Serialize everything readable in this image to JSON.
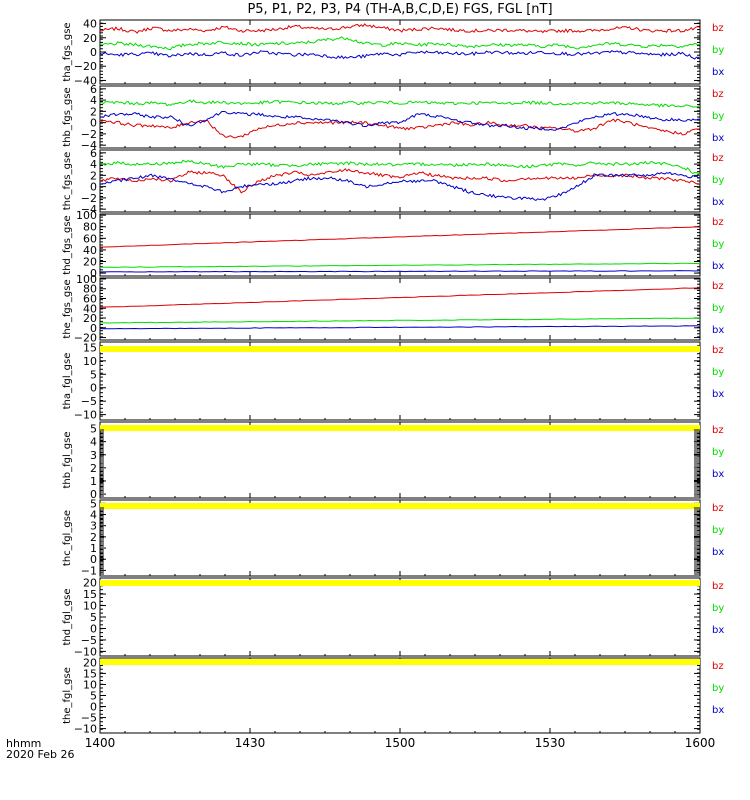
{
  "title": "P5, P1, P2, P3, P4 (TH-A,B,C,D,E) FGS, FGL [nT]",
  "footer": {
    "time_format": "hhmm",
    "date": "2020 Feb 26"
  },
  "colors": {
    "bz": "#dd0000",
    "by": "#00dd00",
    "bx": "#0000cc",
    "flag": "#ffff00",
    "axis": "#000000"
  },
  "chart_data": [
    {
      "type": "line",
      "ylabel": "tha_fgs_gse",
      "ylim": [
        -45,
        45
      ],
      "yticks": [
        "40",
        "20",
        "0",
        "−20",
        "−40"
      ],
      "ytick_values": [
        40,
        20,
        0,
        -20,
        -40
      ],
      "legend": [
        "bz",
        "by",
        "bx"
      ],
      "x": [
        "1400",
        "1430",
        "1500",
        "1530",
        "1600"
      ],
      "series": [
        {
          "name": "bz",
          "values": [
            30,
            33,
            28,
            34,
            30,
            32,
            30,
            35,
            30,
            30,
            32,
            36,
            33,
            32,
            35,
            38,
            34,
            30,
            32,
            34,
            31,
            30,
            30,
            31,
            30,
            28,
            30,
            30,
            30,
            33,
            34,
            30,
            30,
            30,
            34
          ]
        },
        {
          "name": "by",
          "values": [
            10,
            12,
            10,
            8,
            5,
            11,
            12,
            14,
            12,
            10,
            12,
            12,
            14,
            18,
            20,
            12,
            10,
            12,
            10,
            12,
            10,
            8,
            10,
            10,
            10,
            8,
            10,
            6,
            10,
            12,
            10,
            8,
            10,
            8,
            12
          ]
        },
        {
          "name": "bx",
          "values": [
            -2,
            -4,
            -3,
            -2,
            -6,
            -2,
            -4,
            -1,
            -5,
            0,
            -2,
            -4,
            -3,
            -6,
            -8,
            -6,
            -2,
            -4,
            0,
            -1,
            -2,
            -3,
            0,
            -1,
            -2,
            0,
            -2,
            -3,
            -2,
            0,
            -1,
            -3,
            -4,
            -2,
            -10
          ]
        }
      ]
    },
    {
      "type": "line",
      "ylabel": "thb_fgs_gse",
      "ylim": [
        -4.5,
        6.5
      ],
      "yticks": [
        "6",
        "4",
        "2",
        "0",
        "−2",
        "−4"
      ],
      "ytick_values": [
        6,
        4,
        2,
        0,
        -2,
        -4
      ],
      "legend": [
        "bz",
        "by",
        "bx"
      ],
      "x": [
        "1400",
        "1430",
        "1500",
        "1530",
        "1600"
      ],
      "series": [
        {
          "name": "bz",
          "values": [
            0.5,
            0,
            -0.5,
            -0.5,
            -1,
            0,
            0.5,
            -2.5,
            -2.5,
            -1,
            -0.5,
            0,
            0,
            0,
            0,
            0,
            -0.5,
            -1,
            -1,
            -0.5,
            0,
            -0.5,
            0,
            -0.5,
            -0.5,
            -1,
            -1,
            -1.5,
            -1,
            0.5,
            0,
            -1,
            -1.5,
            -2,
            -1
          ]
        },
        {
          "name": "by",
          "values": [
            3.5,
            3.6,
            3.4,
            3.5,
            3.2,
            3.8,
            3.6,
            3.6,
            3.4,
            3.5,
            3.7,
            3.6,
            3.5,
            3.4,
            3.5,
            3.5,
            3.6,
            3.5,
            3.6,
            3.5,
            3.4,
            3.5,
            3.5,
            3.4,
            3.6,
            3.5,
            3.4,
            3.4,
            3.5,
            3.5,
            3.4,
            3.2,
            3.0,
            2.9,
            2.9
          ]
        },
        {
          "name": "bx",
          "values": [
            1.0,
            1.5,
            1.5,
            1.0,
            1.0,
            -0.5,
            0.5,
            2.0,
            1.5,
            1.5,
            1.0,
            1.0,
            0.5,
            0.5,
            0,
            -0.5,
            0,
            0,
            1.5,
            1.2,
            0.5,
            0,
            -0.5,
            -0.5,
            -1,
            -1,
            -1.2,
            0,
            1.0,
            1.5,
            1.5,
            1.0,
            0.5,
            0.5,
            0.5
          ]
        }
      ]
    },
    {
      "type": "line",
      "ylabel": "thc_fgs_gse",
      "ylim": [
        -4.5,
        6.5
      ],
      "yticks": [
        "6",
        "4",
        "2",
        "0",
        "−2",
        "−4"
      ],
      "ytick_values": [
        6,
        4,
        2,
        0,
        -2,
        -4
      ],
      "legend": [
        "bz",
        "by",
        "bx"
      ],
      "x": [
        "1400",
        "1430",
        "1500",
        "1530",
        "1600"
      ],
      "series": [
        {
          "name": "bz",
          "values": [
            1.0,
            1.5,
            1.0,
            1.5,
            1.0,
            2.5,
            2.5,
            2.0,
            -1.0,
            1.0,
            2.0,
            2.5,
            2.0,
            2.5,
            3.0,
            2.5,
            2.0,
            1.5,
            2.5,
            2.0,
            1.5,
            1.5,
            1.5,
            1.0,
            1.5,
            1.5,
            1.5,
            1.5,
            2.0,
            2.0,
            2.0,
            1.5,
            1.5,
            1.0,
            0.5
          ]
        },
        {
          "name": "by",
          "values": [
            4.0,
            4.2,
            4.0,
            4.0,
            4.2,
            4.5,
            4.0,
            3.5,
            4.0,
            4.0,
            3.8,
            3.8,
            4.0,
            4.0,
            4.2,
            4.0,
            4.0,
            3.8,
            4.0,
            4.0,
            3.8,
            4.0,
            4.0,
            3.8,
            3.5,
            3.8,
            4.0,
            3.8,
            4.2,
            4.0,
            4.0,
            4.2,
            4.0,
            3.5,
            2.0
          ]
        },
        {
          "name": "bx",
          "values": [
            0.5,
            1.0,
            1.5,
            2.0,
            1.5,
            0.5,
            0,
            -1.0,
            0,
            0.5,
            0.5,
            1.0,
            1.5,
            1.5,
            1.0,
            0,
            0.5,
            1.0,
            1.0,
            1.0,
            0,
            -1.0,
            -1.5,
            -2.0,
            -2.0,
            -2.5,
            -1.5,
            0,
            2.0,
            2.0,
            2.0,
            2.0,
            2.5,
            2.0,
            1.5
          ]
        }
      ]
    },
    {
      "type": "line",
      "ylabel": "thd_fgs_gse",
      "ylim": [
        -5,
        102
      ],
      "yticks": [
        "100",
        "80",
        "60",
        "40",
        "20",
        "0"
      ],
      "ytick_values": [
        100,
        80,
        60,
        40,
        20,
        0
      ],
      "legend": [
        "bz",
        "by",
        "bx"
      ],
      "x": [
        "1400",
        "1430",
        "1500",
        "1530",
        "1600"
      ],
      "series": [
        {
          "name": "bz",
          "values": [
            45,
            80
          ]
        },
        {
          "name": "by",
          "values": [
            10,
            17
          ]
        },
        {
          "name": "bx",
          "values": [
            2,
            4
          ]
        }
      ]
    },
    {
      "type": "line",
      "ylabel": "the_fgs_gse",
      "ylim": [
        -25,
        102
      ],
      "yticks": [
        "100",
        "80",
        "60",
        "40",
        "20",
        "0",
        "−20"
      ],
      "ytick_values": [
        100,
        80,
        60,
        40,
        20,
        0,
        -20
      ],
      "legend": [
        "bz",
        "by",
        "bx"
      ],
      "x": [
        "1400",
        "1430",
        "1500",
        "1530",
        "1600"
      ],
      "series": [
        {
          "name": "bz",
          "values": [
            42,
            82
          ]
        },
        {
          "name": "by",
          "values": [
            10,
            20
          ]
        },
        {
          "name": "bx",
          "values": [
            -2,
            4
          ]
        }
      ]
    },
    {
      "type": "line",
      "ylabel": "tha_fgl_gse",
      "ylim": [
        -12,
        17
      ],
      "yticks": [
        "15",
        "10",
        "5",
        "0",
        "−5",
        "−10"
      ],
      "ytick_values": [
        15,
        10,
        5,
        0,
        -5,
        -10
      ],
      "legend": [
        "bz",
        "by",
        "bx"
      ],
      "x": [
        "1400",
        "1430",
        "1500",
        "1530",
        "1600"
      ],
      "series": []
    },
    {
      "type": "line",
      "ylabel": "thb_fgl_gse",
      "ylim": [
        -0.3,
        5.5
      ],
      "yticks": [
        "5",
        "4",
        "3",
        "2",
        "1",
        "0"
      ],
      "ytick_values": [
        5,
        4,
        3,
        2,
        1,
        0
      ],
      "legend": [
        "bz",
        "by",
        "bx"
      ],
      "x": [
        "1400",
        "1430",
        "1500",
        "1530",
        "1600"
      ],
      "series": []
    },
    {
      "type": "line",
      "ylabel": "thc_fgl_gse",
      "ylim": [
        -1.5,
        5.3
      ],
      "yticks": [
        "5",
        "4",
        "3",
        "2",
        "1",
        "0",
        "−1"
      ],
      "ytick_values": [
        5,
        4,
        3,
        2,
        1,
        0,
        -1
      ],
      "legend": [
        "bz",
        "by",
        "bx"
      ],
      "x": [
        "1400",
        "1430",
        "1500",
        "1530",
        "1600"
      ],
      "series": []
    },
    {
      "type": "line",
      "ylabel": "thd_fgl_gse",
      "ylim": [
        -12,
        22
      ],
      "yticks": [
        "20",
        "15",
        "10",
        "5",
        "0",
        "−5",
        "−10"
      ],
      "ytick_values": [
        20,
        15,
        10,
        5,
        0,
        -5,
        -10
      ],
      "legend": [
        "bz",
        "by",
        "bx"
      ],
      "x": [
        "1400",
        "1430",
        "1500",
        "1530",
        "1600"
      ],
      "series": []
    },
    {
      "type": "line",
      "ylabel": "the_fgl_gse",
      "ylim": [
        -12,
        22
      ],
      "yticks": [
        "20",
        "15",
        "10",
        "5",
        "0",
        "−5",
        "−10"
      ],
      "ytick_values": [
        20,
        15,
        10,
        5,
        0,
        -5,
        -10
      ],
      "legend": [
        "bz",
        "by",
        "bx"
      ],
      "x": [
        "1400",
        "1430",
        "1500",
        "1530",
        "1600"
      ],
      "series": []
    }
  ]
}
